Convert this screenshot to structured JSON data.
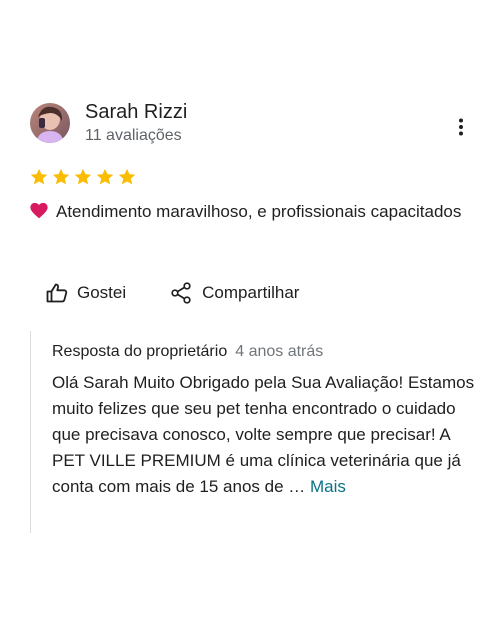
{
  "review": {
    "author": {
      "name": "Sarah Rizzi",
      "review_count": "11 avaliações"
    },
    "rating": 5,
    "rating_max": 5,
    "star_color": "#fbbc04",
    "text": "Atendimento maravilhoso, e profissionais capacitados",
    "text_icon": "heart-icon",
    "actions": {
      "like_label": "Gostei",
      "share_label": "Compartilhar"
    },
    "owner_reply": {
      "label": "Resposta do proprietário",
      "time": "4 anos atrás",
      "text": "Olá Sarah Muito Obrigado pela Sua Avaliação! Estamos muito felizes que seu pet tenha encontrado o cuidado que precisava conosco, volte sempre que precisar! A PET VILLE PREMIUM é uma clínica veterinária que já conta com mais de 15 anos de …",
      "more_label": "Mais"
    }
  },
  "icons": {
    "more": "more-vert-icon",
    "like": "thumb-up-icon",
    "share": "share-icon"
  },
  "colors": {
    "link": "#0b7285",
    "heart": "#d81b60",
    "secondary_text": "#5f6368"
  }
}
